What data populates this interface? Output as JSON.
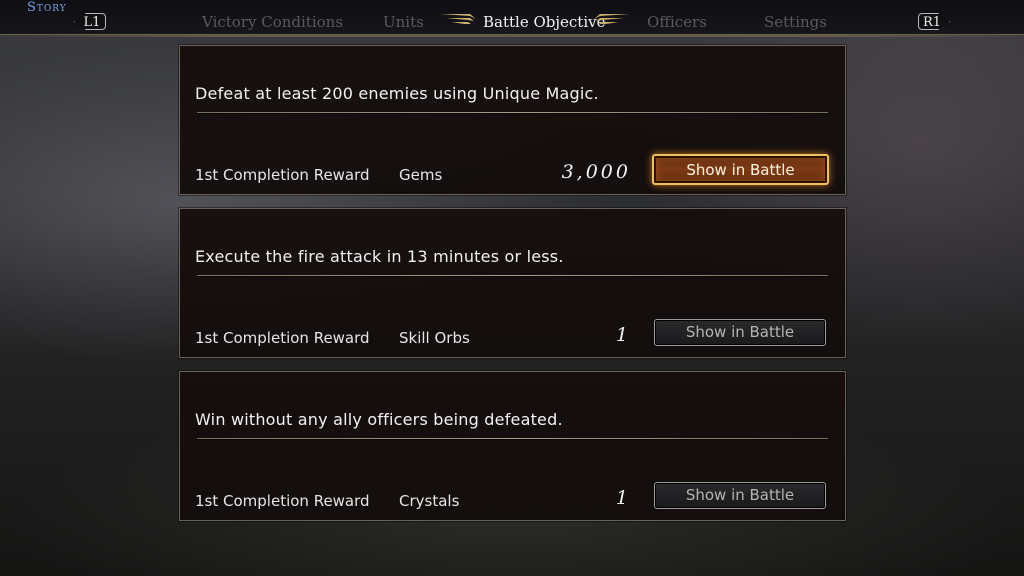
{
  "header": {
    "mode": "Story",
    "left_shoulder": "L1",
    "right_shoulder": "R1",
    "tabs": [
      {
        "label": "Victory Conditions",
        "active": false
      },
      {
        "label": "Units",
        "active": false
      },
      {
        "label": "Battle Objective",
        "active": true
      },
      {
        "label": "Officers",
        "active": false
      },
      {
        "label": "Settings",
        "active": false
      }
    ]
  },
  "objectives": [
    {
      "text": "Defeat at least 200 enemies using Unique Magic.",
      "reward_label": "1st Completion Reward",
      "reward_item": "Gems",
      "reward_amount": "3,000",
      "button": "Show in Battle",
      "selected": true
    },
    {
      "text": "Execute the fire attack in 13 minutes or less.",
      "reward_label": "1st Completion Reward",
      "reward_item": "Skill Orbs",
      "reward_amount": "1",
      "button": "Show in Battle",
      "selected": false
    },
    {
      "text": "Win without any ally officers being defeated.",
      "reward_label": "1st Completion Reward",
      "reward_item": "Crystals",
      "reward_amount": "1",
      "button": "Show in Battle",
      "selected": false
    }
  ],
  "colors": {
    "accent_gold": "#f0c060",
    "selected_button_fill": "#7e3a16",
    "mode_label": "#79a6e8",
    "inactive_tab": "#5a5a5d"
  }
}
